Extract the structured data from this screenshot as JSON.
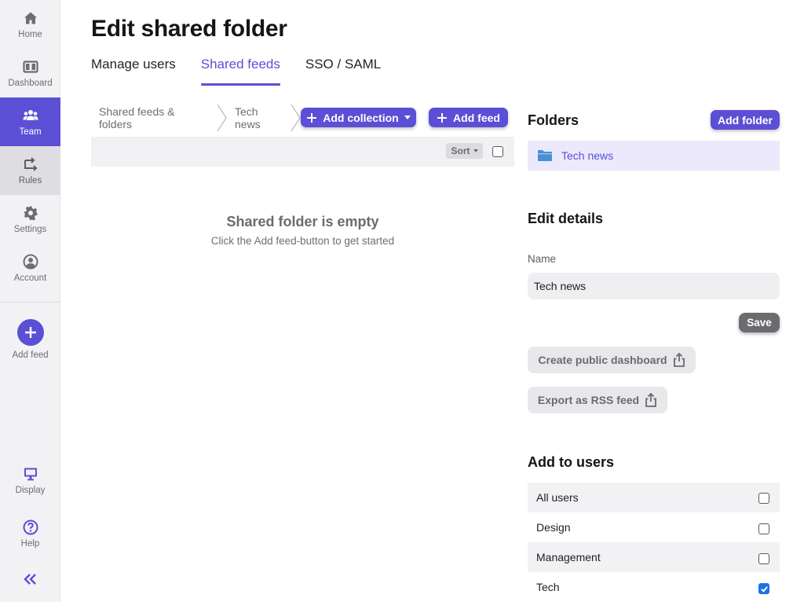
{
  "sidebar": {
    "items": [
      {
        "label": "Home",
        "icon": "home-icon"
      },
      {
        "label": "Dashboard",
        "icon": "dashboard-icon"
      },
      {
        "label": "Team",
        "icon": "team-icon",
        "state": "active"
      },
      {
        "label": "Rules",
        "icon": "rules-icon",
        "state": "highlighted"
      },
      {
        "label": "Settings",
        "icon": "gear-icon"
      },
      {
        "label": "Account",
        "icon": "account-icon"
      },
      {
        "label": "Add feed",
        "icon": "plus-icon"
      },
      {
        "label": "Display",
        "icon": "monitor-icon"
      },
      {
        "label": "Help",
        "icon": "help-icon"
      }
    ]
  },
  "page": {
    "title": "Edit shared folder"
  },
  "tabs": [
    {
      "label": "Manage users",
      "active": false
    },
    {
      "label": "Shared feeds",
      "active": true
    },
    {
      "label": "SSO / SAML",
      "active": false
    }
  ],
  "breadcrumb": [
    {
      "label": "Shared feeds & folders"
    },
    {
      "label": "Tech news"
    }
  ],
  "toolbar": {
    "add_collection_label": "Add collection",
    "add_feed_label": "Add feed",
    "sort_label": "Sort"
  },
  "empty_state": {
    "title": "Shared folder is empty",
    "subtitle": "Click the Add feed-button to get started"
  },
  "folders": {
    "title": "Folders",
    "add_folder_label": "Add folder",
    "items": [
      {
        "name": "Tech news"
      }
    ]
  },
  "edit_details": {
    "title": "Edit details",
    "name_label": "Name",
    "name_value": "Tech news",
    "save_label": "Save",
    "create_dashboard_label": "Create public dashboard",
    "export_rss_label": "Export as RSS feed"
  },
  "add_to_users": {
    "title": "Add to users",
    "users": [
      {
        "name": "All users",
        "checked": false
      },
      {
        "name": "Design",
        "checked": false
      },
      {
        "name": "Management",
        "checked": false
      },
      {
        "name": "Tech",
        "checked": true
      }
    ]
  },
  "colors": {
    "accent": "#5b4fd6",
    "sidebar_bg": "#f2f2f4",
    "checkbox_checked": "#1a73e8",
    "folder_icon": "#4a8fd6"
  }
}
